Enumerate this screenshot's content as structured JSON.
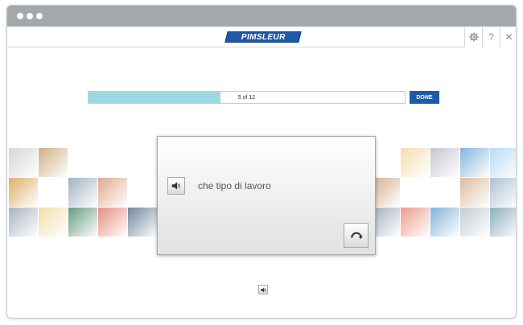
{
  "window": {
    "dots": [
      "#ffffff",
      "#ffffff",
      "#ffffff"
    ]
  },
  "header": {
    "logo_text": "PIMSLEUR",
    "icons": [
      "gear-icon",
      "help-icon",
      "close-icon"
    ],
    "help_label": "?",
    "close_label": "✕"
  },
  "progress": {
    "label": "5 of 12",
    "current": 5,
    "total": 12,
    "fill_color": "#9dd8e2"
  },
  "done_button": {
    "label": "DONE",
    "color": "#1e5aa8"
  },
  "card": {
    "phrase": "che tipo di lavoro",
    "speaker_icon": "speaker-icon",
    "replay_icon": "replay-icon"
  },
  "bottom": {
    "speaker_icon": "speaker-icon"
  },
  "left_strip": [
    "#cfcfcf",
    "#c9a26f",
    "#ffffff",
    "#ffffff",
    "#ffffff",
    "#d8a24a",
    "#ffffff",
    "#8fa6b8",
    "#d99a7a",
    "#ffffff",
    "#9aa7b3",
    "#f2d79a",
    "#4a8a6a",
    "#e07a6a",
    "#5a6f8a"
  ],
  "right_strip": [
    "#ffffff",
    "#f3d7a3",
    "#b9bdc2",
    "#6fa8d8",
    "#a9d4f2",
    "#c9a07a",
    "#ffffff",
    "#ffffff",
    "#d7b08a",
    "#9fb7c8",
    "#8fa0ad",
    "#e88a7a",
    "#6ba5d5",
    "#b7c3cc",
    "#7aa0b5"
  ]
}
